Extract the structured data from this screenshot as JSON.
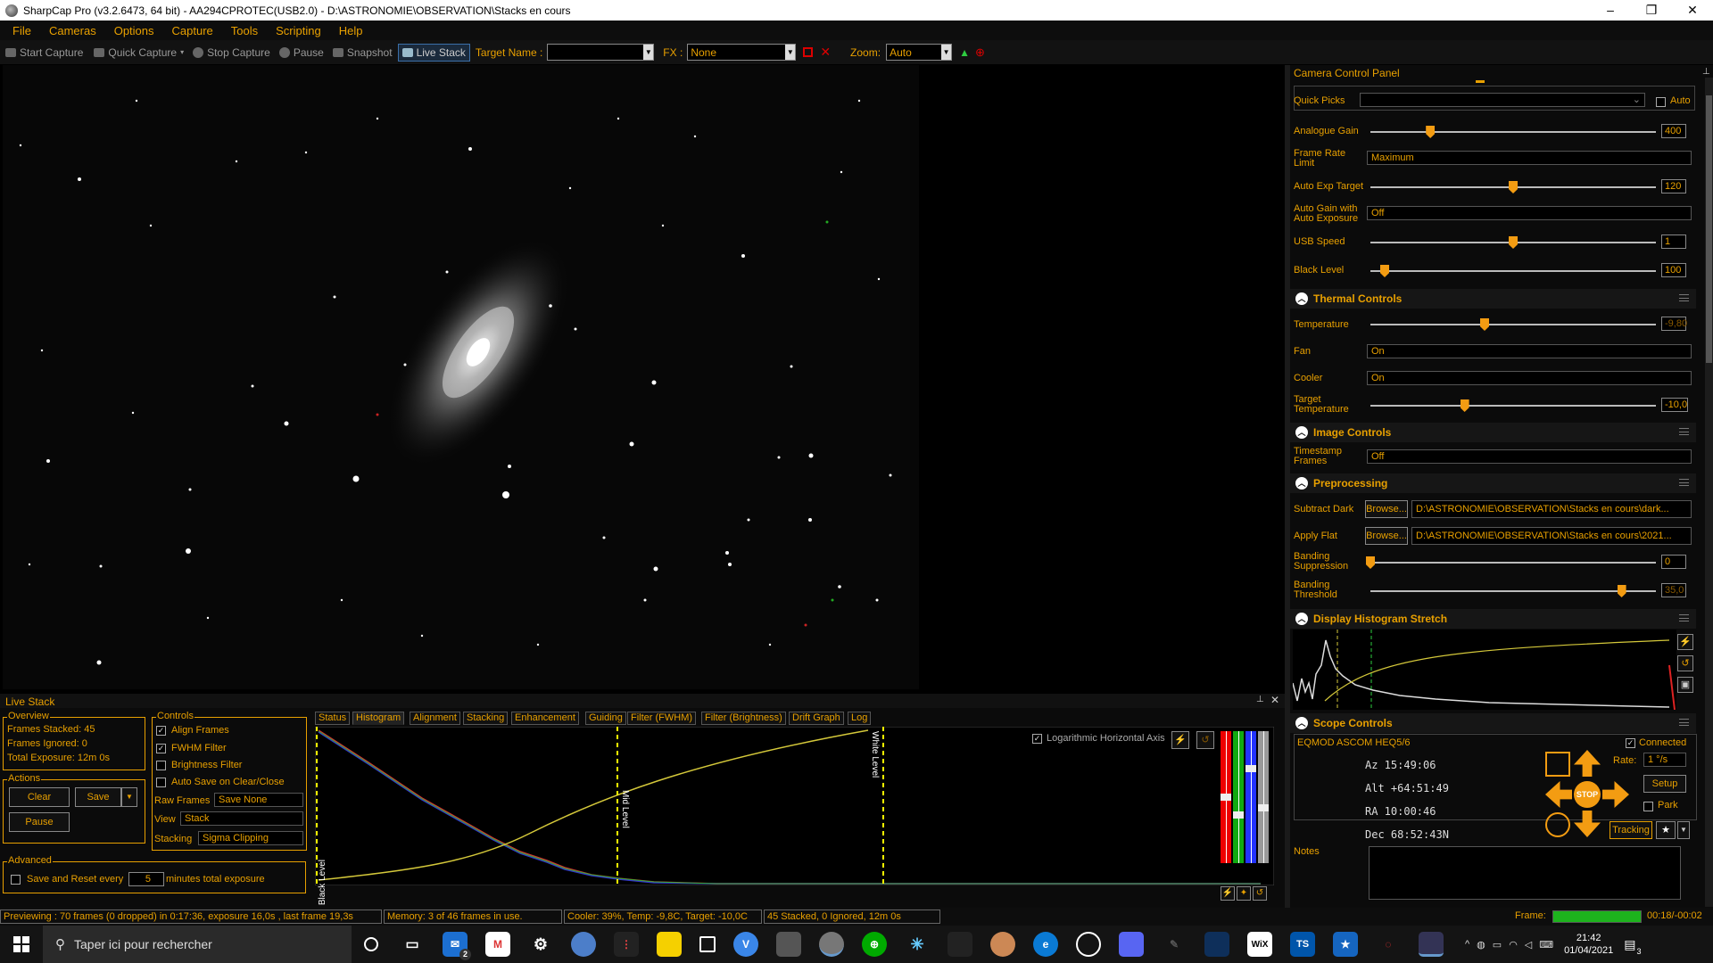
{
  "window": {
    "title": "SharpCap Pro (v3.2.6473, 64 bit) - AA294CPROTEC(USB2.0) - D:\\ASTRONOMIE\\OBSERVATION\\Stacks en cours",
    "min": "–",
    "max": "❐",
    "close": "✕"
  },
  "menu": [
    "File",
    "Cameras",
    "Options",
    "Capture",
    "Tools",
    "Scripting",
    "Help"
  ],
  "toolbar": {
    "start_capture": "Start Capture",
    "quick_capture": "Quick Capture",
    "stop_capture": "Stop Capture",
    "pause": "Pause",
    "snapshot": "Snapshot",
    "live_stack": "Live Stack",
    "target_name_label": "Target Name :",
    "target_name_value": "",
    "fx_label": "FX :",
    "fx_value": "None",
    "zoom_label": "Zoom:",
    "zoom_value": "Auto"
  },
  "camera_panel": {
    "title": "Camera Control Panel",
    "quick_picks": "Quick Picks",
    "auto": "Auto",
    "analogue_gain": {
      "label": "Analogue Gain",
      "value": "400",
      "level": 0.21
    },
    "frame_rate": {
      "label": "Frame Rate Limit",
      "value": "Maximum"
    },
    "auto_exp_target": {
      "label": "Auto Exp Target",
      "value": "120",
      "level": 0.5
    },
    "auto_gain": {
      "label": "Auto Gain with Auto Exposure",
      "value": "Off"
    },
    "usb_speed": {
      "label": "USB Speed",
      "value": "1",
      "level": 0.5
    },
    "black_level": {
      "label": "Black Level",
      "value": "100",
      "level": 0.05
    },
    "thermal": {
      "title": "Thermal Controls",
      "temperature_label": "Temperature",
      "temperature_value": "-9,80",
      "temperature_level": 0.4,
      "fan_label": "Fan",
      "fan_value": "On",
      "cooler_label": "Cooler",
      "cooler_value": "On",
      "target_temp_label": "Target Temperature",
      "target_temp_value": "-10,0",
      "target_temp_level": 0.33
    },
    "image": {
      "title": "Image Controls",
      "timestamp_label": "Timestamp Frames",
      "timestamp_value": "Off"
    },
    "preproc": {
      "title": "Preprocessing",
      "dark_label": "Subtract Dark",
      "browse": "Browse...",
      "dark_path": "D:\\ASTRONOMIE\\OBSERVATION\\Stacks en cours\\dark...",
      "flat_label": "Apply Flat",
      "flat_path": "D:\\ASTRONOMIE\\OBSERVATION\\Stacks en cours\\2021...",
      "band_supp_label": "Banding Suppression",
      "band_supp_value": "0",
      "band_supp_level": 0.0,
      "band_thr_label": "Banding Threshold",
      "band_thr_value": "35,0",
      "band_thr_level": 0.88
    },
    "histo": {
      "title": "Display Histogram Stretch"
    },
    "scope": {
      "title": "Scope Controls",
      "driver": "EQMOD ASCOM HEQ5/6",
      "connected": "Connected",
      "az": "Az  15:49:06",
      "alt": "Alt +64:51:49",
      "ra": "RA  10:00:46",
      "dec": "Dec  68:52:43N",
      "rate_label": "Rate:",
      "rate_value": "1 °/s",
      "setup": "Setup",
      "park": "Park",
      "tracking": "Tracking",
      "stop": "STOP"
    },
    "notes": "Notes"
  },
  "live_stack": {
    "title": "Live Stack",
    "overview": {
      "title": "Overview",
      "stacked": "Frames Stacked: 45",
      "ignored": "Frames Ignored:  0",
      "exposure": "Total Exposure:   12m 0s"
    },
    "actions": {
      "title": "Actions",
      "clear": "Clear",
      "save": "Save",
      "pause": "Pause"
    },
    "advanced": {
      "title": "Advanced",
      "save_reset": "Save and Reset every",
      "minutes_value": "5",
      "minutes_label": "minutes total exposure"
    },
    "controls": {
      "title": "Controls",
      "align": "Align Frames",
      "fwhm": "FWHM Filter",
      "brightness": "Brightness Filter",
      "autosave": "Auto Save on Clear/Close",
      "raw_label": "Raw Frames",
      "raw_value": "Save None",
      "view_label": "View",
      "view_value": "Stack",
      "stacking_label": "Stacking",
      "stacking_value": "Sigma Clipping"
    },
    "tabs": [
      "Status",
      "Histogram",
      "Alignment",
      "Stacking",
      "Enhancement",
      "Guiding",
      "Filter (FWHM)",
      "Filter (Brightness)",
      "Drift Graph",
      "Log"
    ],
    "log_axis": "Logarithmic Horizontal Axis",
    "black_level": "Black Level",
    "mid_level": "Mid Level",
    "white_level": "White Level"
  },
  "status": {
    "preview": "Previewing : 70 frames (0 dropped) in 0:17:36, exposure 16,0s , last frame 19,3s",
    "memory": "Memory: 3 of 46 frames in use.",
    "cooler": "Cooler: 39%, Temp: -9,8C, Target: -10,0C",
    "stacked": "45 Stacked, 0 Ignored, 12m 0s",
    "frame_label": "Frame:",
    "frame_time": "00:18/-00:02",
    "frame_progress": 1.0
  },
  "taskbar": {
    "search": "Taper ici pour rechercher",
    "time": "21:42",
    "date": "01/04/2021",
    "mail_badge": "2",
    "notif_badge": "3"
  },
  "colors": {
    "accent": "#e8a000",
    "orange": "#f39c12",
    "green": "#1db31d"
  }
}
